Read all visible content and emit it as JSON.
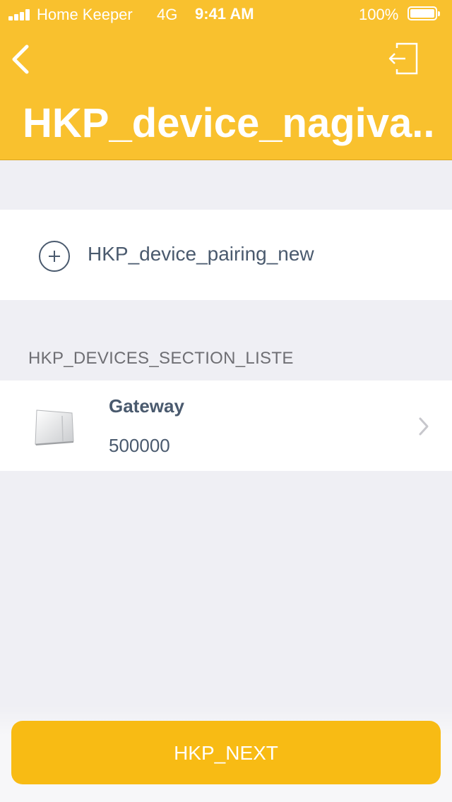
{
  "status_bar": {
    "carrier": "Home Keeper",
    "network": "4G",
    "time": "9:41 AM",
    "battery": "100%"
  },
  "header": {
    "title": "HKP_device_nagiva...",
    "back_icon": "chevron-left-icon",
    "logout_icon": "logout-icon",
    "background_color": "#f9c12e"
  },
  "pairing": {
    "label": "HKP_device_pairing_new",
    "icon": "plus-circle-icon"
  },
  "devices_section": {
    "title": "HKP_DEVICES_SECTION_LISTE",
    "devices": [
      {
        "name": "Gateway",
        "id": "500000",
        "icon": "gateway-device-image"
      }
    ]
  },
  "footer": {
    "next_label": "HKP_NEXT",
    "button_color": "#f8bb14"
  }
}
